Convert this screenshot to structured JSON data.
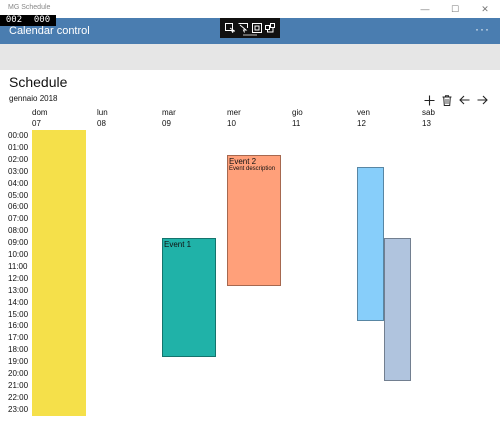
{
  "window": {
    "app_title": "MG Schedule",
    "minimize_glyph": "—",
    "maximize_glyph": "☐",
    "close_glyph": "✕"
  },
  "fps_counter": {
    "left": "002",
    "right": "000"
  },
  "header": {
    "title": "Calendar control",
    "more_glyph": "···"
  },
  "schedule": {
    "title": "Schedule",
    "month": "gennaio 2018",
    "days": [
      {
        "name": "dom",
        "num": "07"
      },
      {
        "name": "lun",
        "num": "08"
      },
      {
        "name": "mar",
        "num": "09"
      },
      {
        "name": "mer",
        "num": "10"
      },
      {
        "name": "gio",
        "num": "11"
      },
      {
        "name": "ven",
        "num": "12"
      },
      {
        "name": "sab",
        "num": "13"
      }
    ],
    "hours": [
      "00:00",
      "01:00",
      "02:00",
      "03:00",
      "04:00",
      "05:00",
      "06:00",
      "07:00",
      "08:00",
      "09:00",
      "10:00",
      "11:00",
      "12:00",
      "13:00",
      "14:00",
      "15:00",
      "16:00",
      "17:00",
      "18:00",
      "19:00",
      "20:00",
      "21:00",
      "22:00",
      "23:00"
    ],
    "events": [
      {
        "title": "",
        "description": "",
        "color": "#f5e04a",
        "day": 0,
        "start": 0,
        "end": 24,
        "lane": 0,
        "lanes": 1
      },
      {
        "title": "Event 1",
        "description": "",
        "color": "#20b2a8",
        "day": 2,
        "start": 9,
        "end": 19,
        "lane": 0,
        "lanes": 1
      },
      {
        "title": "Event 2",
        "description": "Event description",
        "color": "#ffa07a",
        "day": 3,
        "start": 2,
        "end": 13,
        "lane": 0,
        "lanes": 1
      },
      {
        "title": "",
        "description": "",
        "color": "#87cefa",
        "day": 5,
        "start": 3,
        "end": 16,
        "lane": 0,
        "lanes": 2
      },
      {
        "title": "",
        "description": "",
        "color": "#b0c4de",
        "day": 5,
        "start": 9,
        "end": 21,
        "lane": 1,
        "lanes": 2
      }
    ]
  },
  "icons": {
    "add": "add-icon",
    "delete": "trash-icon",
    "back": "arrow-left-icon",
    "forward": "arrow-right-icon"
  }
}
